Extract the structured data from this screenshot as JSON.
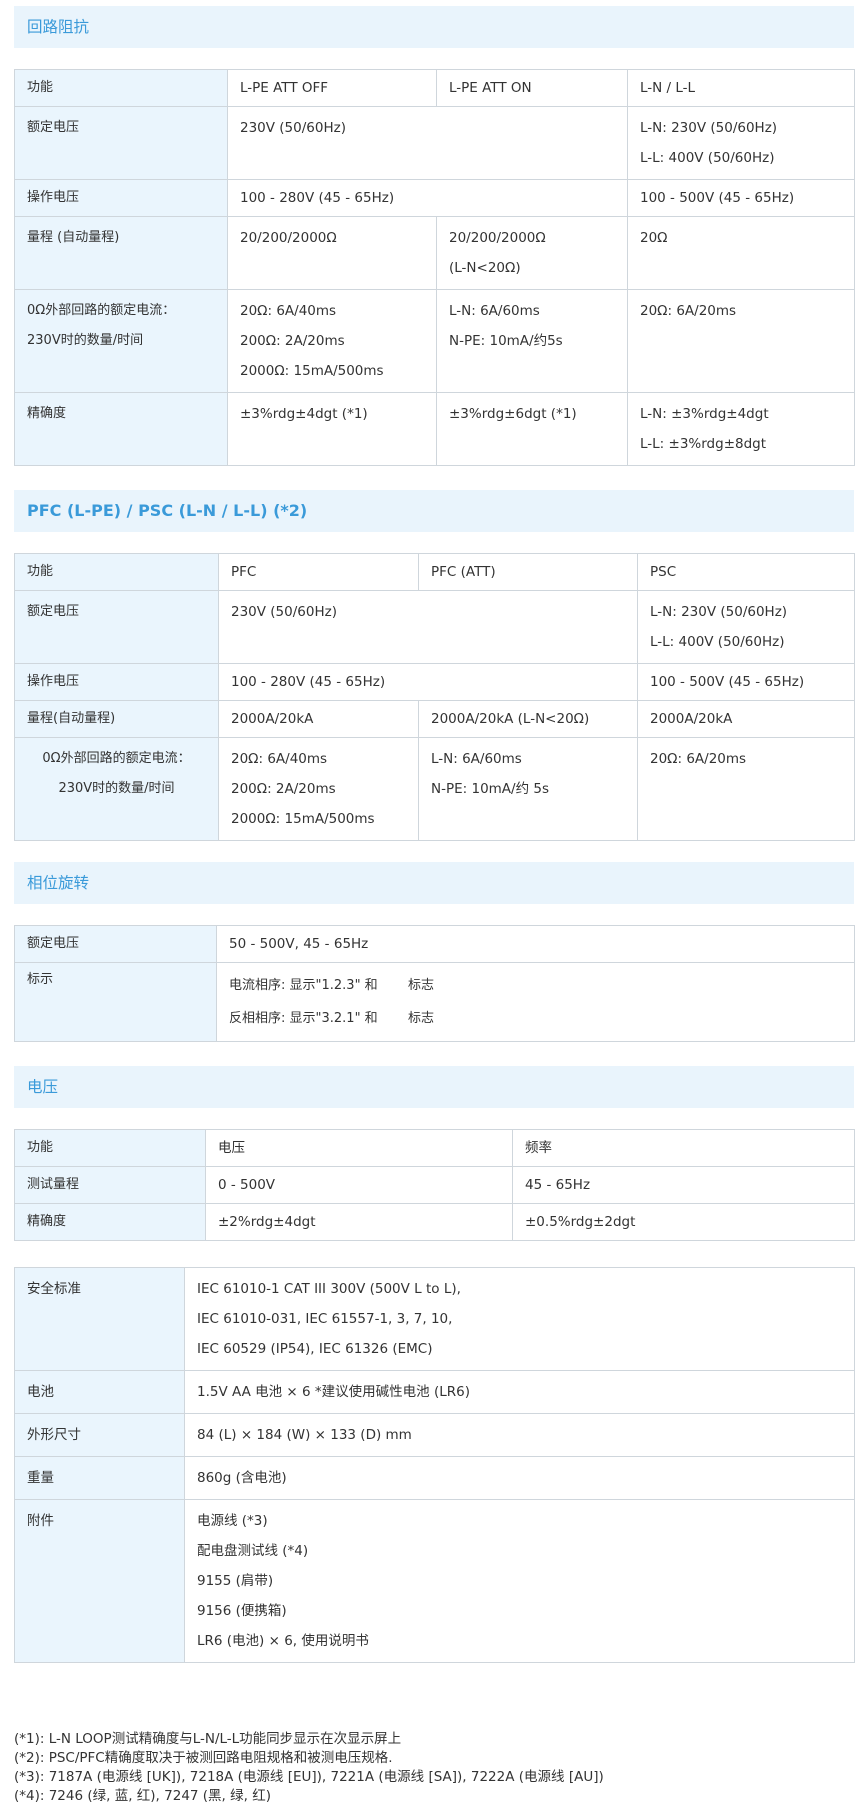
{
  "loop": {
    "title": "回路阻抗",
    "header": [
      "功能",
      "L-PE ATT OFF",
      "L-PE ATT ON",
      "L-N / L-L"
    ],
    "rated_label": "额定电压",
    "rated_val": "230V (50/60Hz)",
    "rated_ln": [
      "L-N: 230V (50/60Hz)",
      "L-L: 400V (50/60Hz)"
    ],
    "op_label": "操作电压",
    "op_val": "100 - 280V (45 - 65Hz)",
    "op_ln": "100 - 500V (45 - 65Hz)",
    "range_label": "量程 (自动量程)",
    "range_off": "20/200/2000Ω",
    "range_on": [
      "20/200/2000Ω",
      "(L-N<20Ω)"
    ],
    "range_ln": "20Ω",
    "cur_label": [
      "0Ω外部回路的额定电流：",
      "230V时的数量/时间"
    ],
    "cur_off": [
      "20Ω: 6A/40ms",
      "200Ω: 2A/20ms",
      "2000Ω: 15mA/500ms"
    ],
    "cur_on": [
      "L-N: 6A/60ms",
      "N-PE: 10mA/约5s"
    ],
    "cur_ln": "20Ω: 6A/20ms",
    "acc_label": "精确度",
    "acc_off": "±3%rdg±4dgt (*1)",
    "acc_on": "±3%rdg±6dgt (*1)",
    "acc_ln": [
      "L-N: ±3%rdg±4dgt",
      "L-L: ±3%rdg±8dgt"
    ]
  },
  "pfc": {
    "title": "PFC (L-PE) / PSC (L-N / L-L) (*2)",
    "header": [
      "功能",
      "PFC",
      "PFC (ATT)",
      "PSC"
    ],
    "rated_label": "额定电压",
    "rated_val": "230V (50/60Hz)",
    "rated_psc": [
      "L-N: 230V (50/60Hz)",
      "L-L: 400V (50/60Hz)"
    ],
    "op_label": "操作电压",
    "op_val": "100 - 280V (45 - 65Hz)",
    "op_psc": "100 - 500V (45 - 65Hz)",
    "range_label": "量程(自动量程)",
    "range_pfc": "2000A/20kA",
    "range_att": "2000A/20kA (L-N<20Ω)",
    "range_psc": "2000A/20kA",
    "cur_label": [
      "0Ω外部回路的额定电流：",
      "230V时的数量/时间"
    ],
    "cur_pfc": [
      "20Ω: 6A/40ms",
      "200Ω: 2A/20ms",
      "2000Ω: 15mA/500ms"
    ],
    "cur_att": [
      "L-N: 6A/60ms",
      "N-PE: 10mA/约 5s"
    ],
    "cur_psc": "20Ω: 6A/20ms"
  },
  "phase": {
    "title": "相位旋转",
    "rated_label": "额定电压",
    "rated_val": "50 - 500V, 45 - 65Hz",
    "ind_label": "标示",
    "ind_a": "电流相序: 显示\"1.2.3\" 和",
    "ind_b": "反相相序: 显示\"3.2.1\" 和",
    "ind_suffix": "标志"
  },
  "voltage": {
    "title": "电压",
    "header": [
      "功能",
      "电压",
      "频率"
    ],
    "range_label": "测试量程",
    "range_v": "0 - 500V",
    "range_f": "45 - 65Hz",
    "acc_label": "精确度",
    "acc_v": "±2%rdg±4dgt",
    "acc_f": "±0.5%rdg±2dgt"
  },
  "general": {
    "safety_label": "安全标准",
    "safety_val": [
      "IEC 61010-1 CAT III 300V (500V L to L),",
      "IEC 61010-031, IEC 61557-1, 3, 7, 10,",
      "IEC 60529 (IP54), IEC 61326 (EMC)"
    ],
    "battery_label": "电池",
    "battery_val": "1.5V AA 电池 × 6 *建议使用碱性电池 (LR6)",
    "dim_label": "外形尺寸",
    "dim_val": "84 (L) × 184 (W) × 133 (D) mm",
    "weight_label": "重量",
    "weight_val": "860g (含电池)",
    "acc_label": "附件",
    "acc_val": [
      "电源线 (*3)",
      "配电盘测试线 (*4)",
      "9155 (肩带)",
      "9156 (便携箱)",
      "LR6 (电池) × 6, 使用说明书"
    ]
  },
  "notes": [
    "(*1): L-N LOOP测试精确度与L-N/L-L功能同步显示在次显示屏上",
    "(*2): PSC/PFC精确度取决于被测回路电阻规格和被测电压规格.",
    "(*3): 7187A (电源线 [UK]), 7218A (电源线 [EU]), 7221A (电源线 [SA]), 7222A (电源线 [AU])",
    "(*4): 7246 (绿, 蓝, 红), 7247 (黑, 绿, 红)"
  ]
}
